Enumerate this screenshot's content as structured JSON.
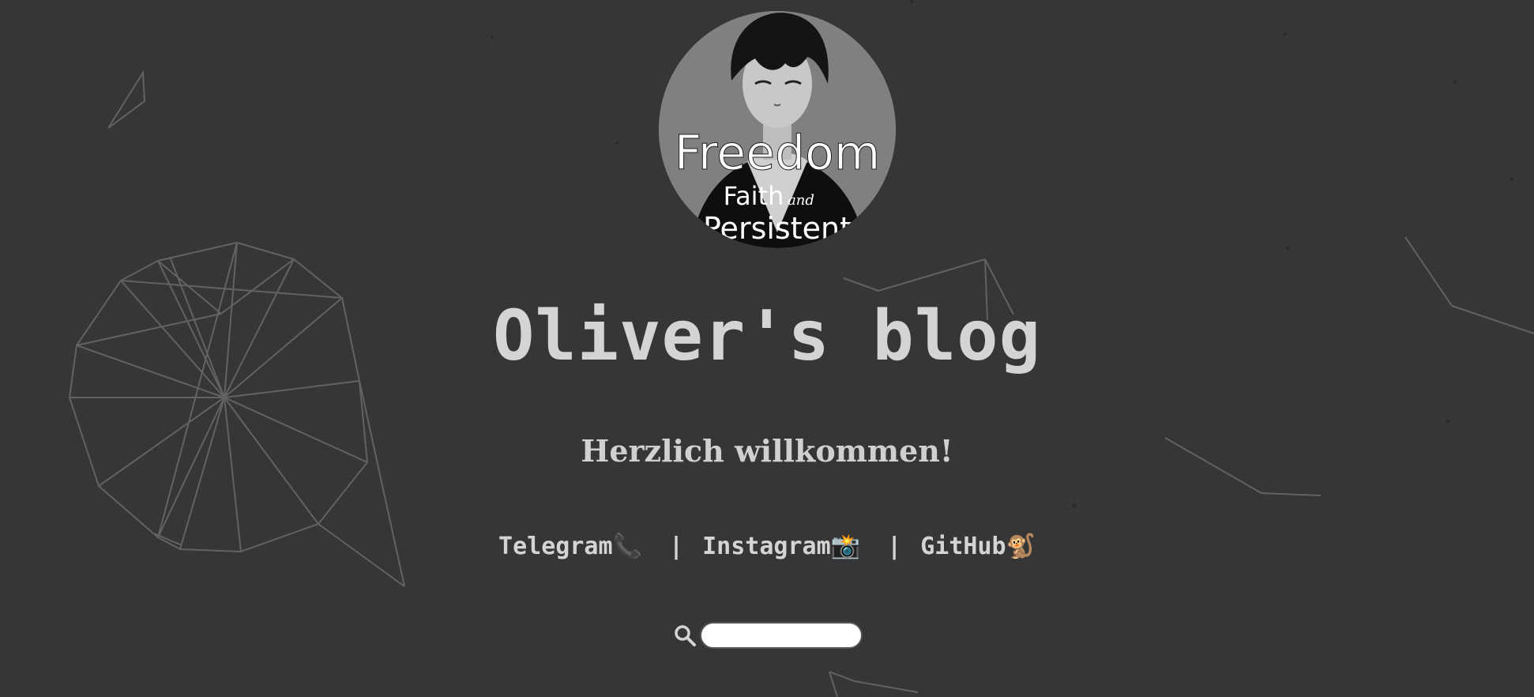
{
  "avatar": {
    "line1": "Freedom",
    "line2": "Faith",
    "line2b": "and",
    "line3": "Persistent"
  },
  "header": {
    "title": "Oliver's blog",
    "welcome": "Herzlich willkommen!"
  },
  "links": [
    {
      "label": "Telegram📞"
    },
    {
      "label": "Instagram📸"
    },
    {
      "label": "GitHub🐒"
    }
  ],
  "separator": "|",
  "search": {
    "value": "",
    "placeholder": "",
    "icon": "search-icon"
  },
  "colors": {
    "background": "#363636",
    "text": "#d4d4d4",
    "network_line": "#6a6a6a"
  }
}
